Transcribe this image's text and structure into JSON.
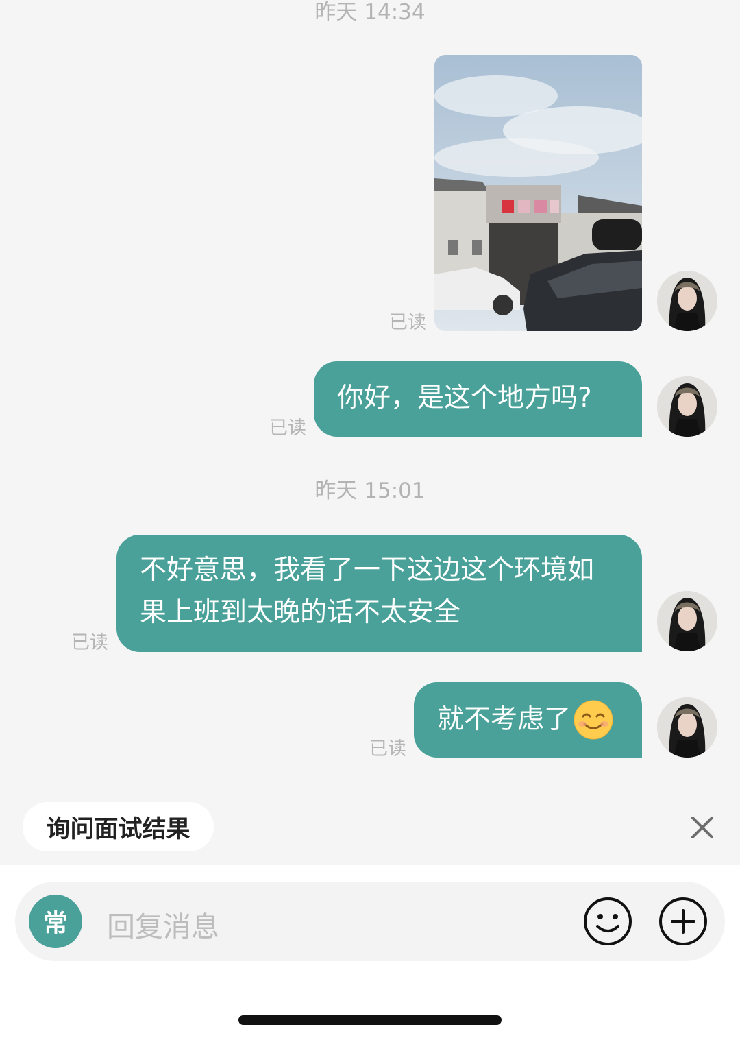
{
  "timestamps": [
    "昨天 14:34",
    "昨天 15:01"
  ],
  "messages": [
    {
      "type": "image",
      "read_status": "已读",
      "alt": "street-photo"
    },
    {
      "type": "text",
      "text": "你好，是这个地方吗?",
      "read_status": "已读"
    },
    {
      "type": "text",
      "line1": "不好意思，我看了一下这边这个环境如",
      "line2": "果上班到太晚的话不太安全",
      "read_status": "已读"
    },
    {
      "type": "text",
      "text": "就不考虑了",
      "emoji": "smiling-face-icon",
      "read_status": "已读"
    }
  ],
  "quick_reply": {
    "label": "询问面试结果",
    "close_icon": "close-icon"
  },
  "composer": {
    "badge": "常",
    "placeholder": "回复消息",
    "emoji_icon": "smiley-icon",
    "plus_icon": "plus-icon"
  },
  "colors": {
    "bubble": "#4aa19a",
    "background": "#f5f5f5"
  }
}
